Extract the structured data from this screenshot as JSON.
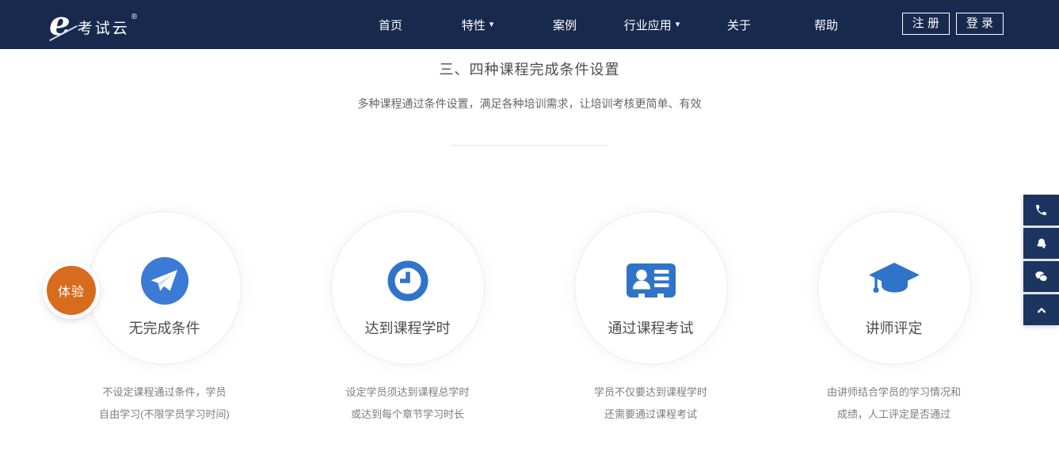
{
  "header": {
    "logo": {
      "symbol": "e",
      "brand": "考试云",
      "registered_mark": "®"
    },
    "nav": [
      {
        "label": "首页"
      },
      {
        "label": "特性",
        "has_dropdown": true
      },
      {
        "label": "案例"
      },
      {
        "label": "行业应用",
        "has_dropdown": true
      },
      {
        "label": "关于"
      },
      {
        "label": "帮助"
      }
    ],
    "register_label": "注 册",
    "login_label": "登 录"
  },
  "icons": {
    "caret_down": "▾"
  },
  "section": {
    "title": "三、四种课程完成条件设置",
    "subtitle": "多种课程通过条件设置，满足各种培训需求，让培训考核更简单、有效"
  },
  "trial_badge": {
    "label": "体验"
  },
  "cards": [
    {
      "icon": "paper-plane-icon",
      "title": "无完成条件",
      "desc_line1": "不设定课程通过条件，学员",
      "desc_line2": "自由学习(不限学员学习时间)"
    },
    {
      "icon": "clock-icon",
      "title": "达到课程学时",
      "desc_line1": "设定学员须达到课程总学时",
      "desc_line2": "或达到每个章节学习时长"
    },
    {
      "icon": "id-card-icon",
      "title": "通过课程考试",
      "desc_line1": "学员不仅要达到课程学时",
      "desc_line2": "还需要通过课程考试"
    },
    {
      "icon": "graduation-cap-icon",
      "title": "讲师评定",
      "desc_line1": "由讲师结合学员的学习情况和",
      "desc_line2": "成绩，人工评定是否通过"
    }
  ],
  "floating_toolbar": {
    "items": [
      {
        "icon": "phone-icon",
        "name": "contact-phone"
      },
      {
        "icon": "qq-icon",
        "name": "contact-qq"
      },
      {
        "icon": "wechat-icon",
        "name": "contact-wechat"
      },
      {
        "icon": "chevron-up-icon",
        "name": "back-to-top"
      }
    ]
  },
  "colors": {
    "header_bg": "#18294E",
    "accent_blue": "#3578D0",
    "badge_orange": "#D76B1E",
    "toolbar_bg": "#1C3560",
    "title_gray": "#4D4D4D",
    "caption_gray": "#7D7D7D"
  }
}
